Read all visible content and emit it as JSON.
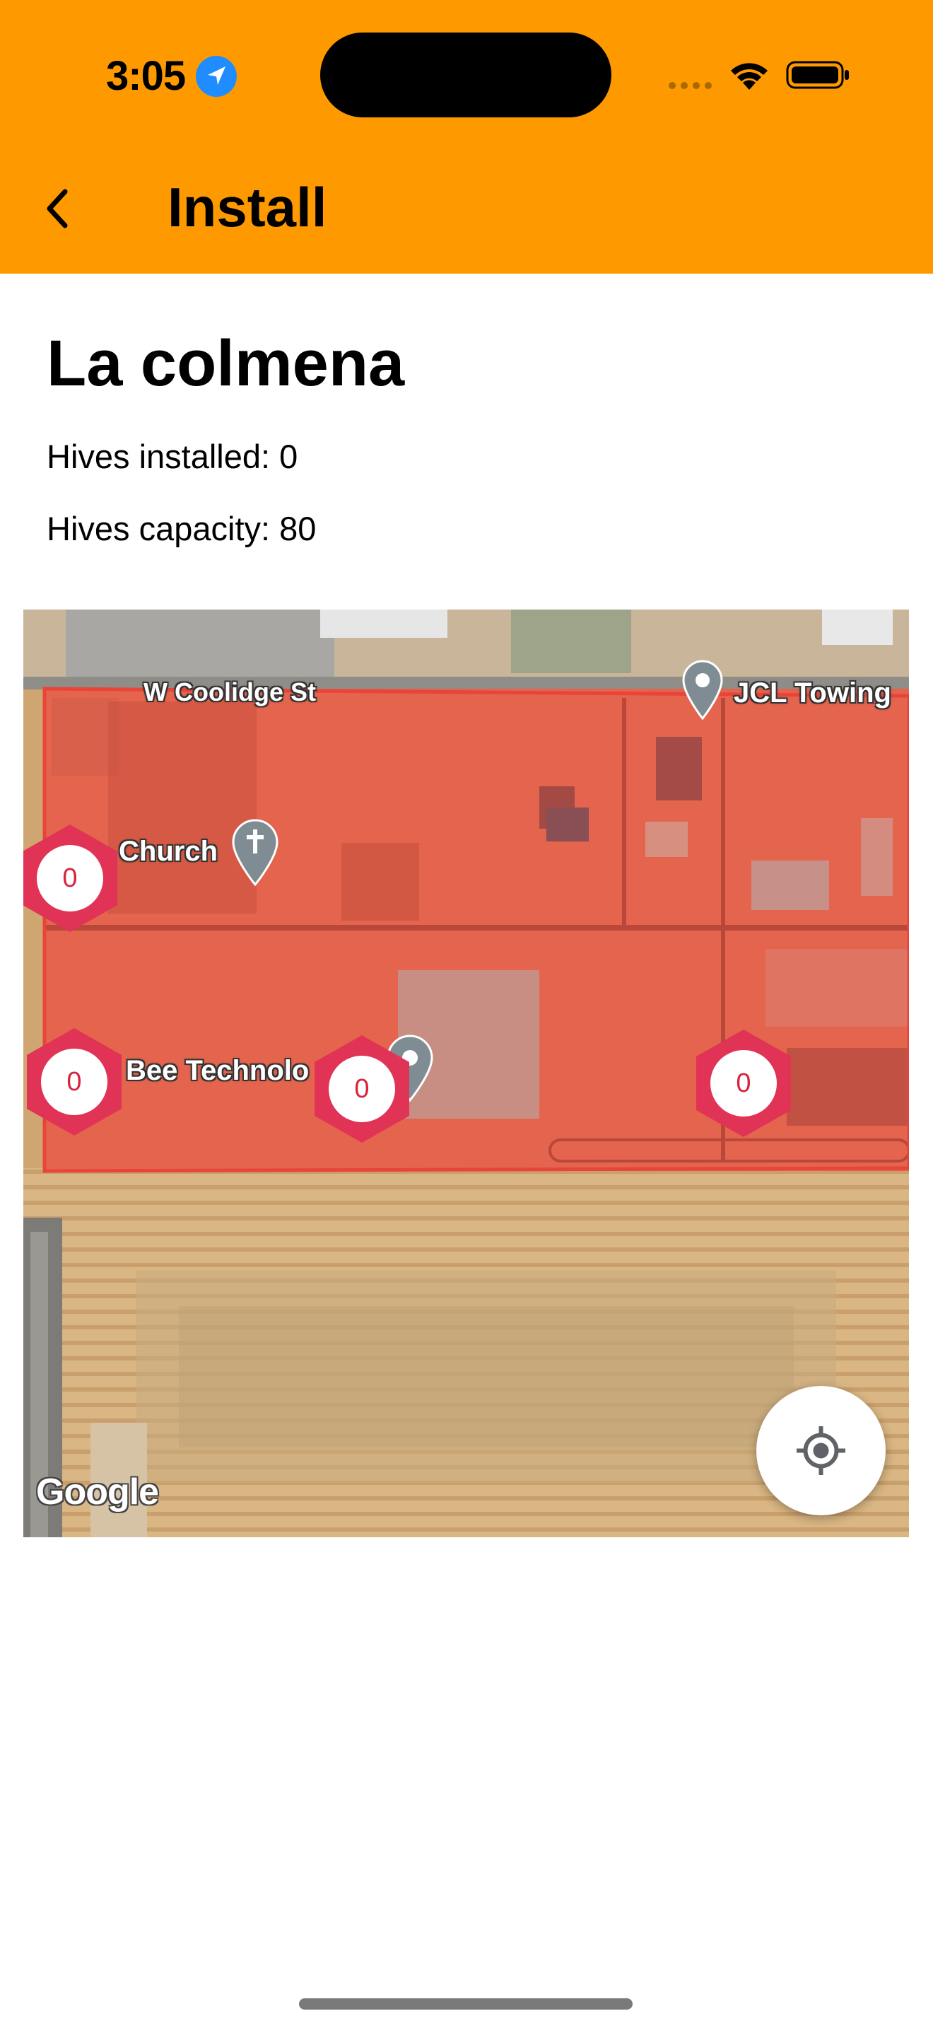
{
  "status_bar": {
    "time": "3:05"
  },
  "header": {
    "title": "Install",
    "color": "#fe9a00"
  },
  "apiary": {
    "name": "La colmena",
    "installed_text": "Hives installed: 0",
    "capacity_text": "Hives capacity: 80"
  },
  "map": {
    "labels": {
      "street": "W Coolidge St",
      "towing": "JCL Towing",
      "church": "Church",
      "bee": "Bee Technolo"
    },
    "clusters": [
      "0",
      "0",
      "0",
      "0",
      "0"
    ],
    "attribution": "Google",
    "boundary_color": "#e8443a"
  }
}
